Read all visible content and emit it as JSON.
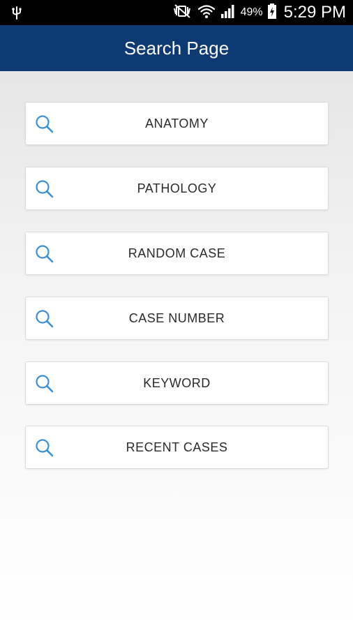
{
  "status_bar": {
    "battery_percent": "49%",
    "time": "5:29 PM"
  },
  "app_bar": {
    "title": "Search Page"
  },
  "menu": {
    "items": [
      {
        "label": "ANATOMY",
        "icon": "search-icon"
      },
      {
        "label": "PATHOLOGY",
        "icon": "search-icon"
      },
      {
        "label": "RANDOM CASE",
        "icon": "search-icon"
      },
      {
        "label": "CASE NUMBER",
        "icon": "search-icon"
      },
      {
        "label": "KEYWORD",
        "icon": "search-icon"
      },
      {
        "label": "RECENT CASES",
        "icon": "search-icon"
      }
    ]
  },
  "colors": {
    "app_bar": "#0e3a74",
    "icon_blue": "#3a8fd6",
    "status_bar": "#000000"
  }
}
